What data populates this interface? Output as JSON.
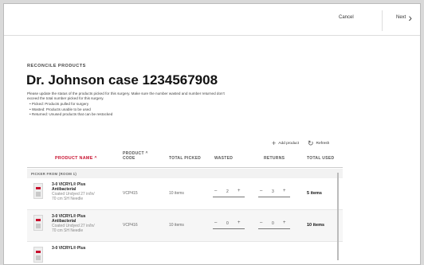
{
  "header": {
    "cancel_label": "Cancel",
    "next_label": "Next"
  },
  "page": {
    "eyebrow": "RECONCILE PRODUCTS",
    "title": "Dr. Johnson case 1234567908",
    "description": "Please update the status of the products picked for this surgery. Make sure the number wasted and number returned don't exceed the total number picked for this surgery.",
    "bullets": [
      "• Picked: Products pulled for surgery",
      "• Wasted: Products unable to be used",
      "• Returned: Unused products that can be restocked"
    ]
  },
  "toolbar": {
    "add_label": "Add product",
    "refresh_label": "Refresh"
  },
  "table": {
    "headers": {
      "name": "PRODUCT NAME ^",
      "code_line1": "PRODUCT ^",
      "code_line2": "CODE",
      "picked": "TOTAL PICKED",
      "wasted": "WASTED",
      "returns": "RETURNS",
      "used": "TOTAL USED"
    },
    "group_label": "PICKER FROM (ROOM 1)",
    "rows": [
      {
        "name1": "3-0 VICRYL® Plus",
        "name2": "Antibacterial",
        "desc1": "Coated Undyed 27 in/ln/",
        "desc2": "70 cm SH Needle",
        "code": "VCP415",
        "picked": "10 items",
        "wasted": "2",
        "returns": "3",
        "used": "5 items"
      },
      {
        "name1": "3-0 VICRYL® Plus",
        "name2": "Antibacterial",
        "desc1": "Coated Undyed 27 in/ln/",
        "desc2": "70 cm SH Needle",
        "code": "VCP416",
        "picked": "10 items",
        "wasted": "0",
        "returns": "0",
        "used": "10 items"
      },
      {
        "name1": "3-0 VICRYL® Plus",
        "name2": "",
        "desc1": "",
        "desc2": "",
        "code": "",
        "picked": "",
        "wasted": "",
        "returns": "",
        "used": ""
      }
    ]
  },
  "icons": {
    "add": "plus-icon",
    "refresh": "refresh-icon",
    "next": "chevron-right-icon"
  },
  "colors": {
    "accent": "#c8102e"
  }
}
